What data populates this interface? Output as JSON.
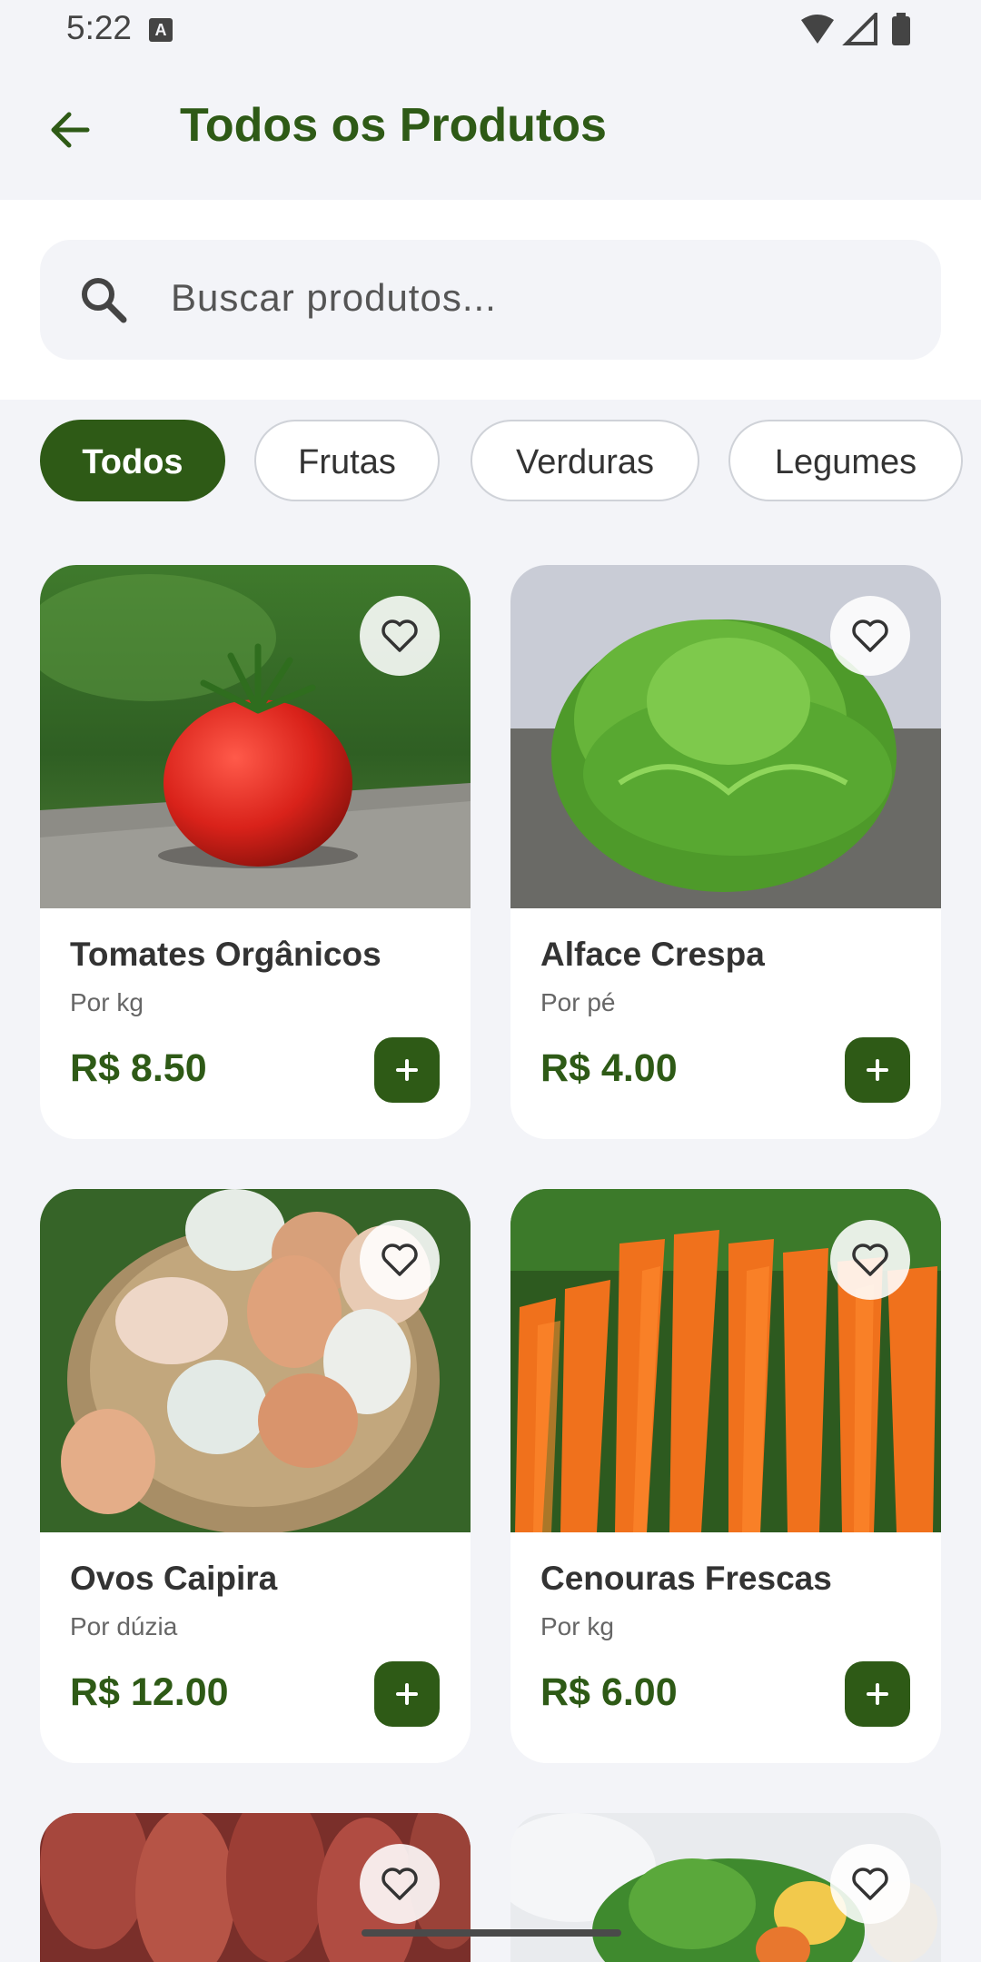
{
  "status": {
    "time": "5:22",
    "notification_glyph": "A"
  },
  "appbar": {
    "title": "Todos os Produtos"
  },
  "search": {
    "placeholder": "Buscar produtos..."
  },
  "filters": [
    {
      "label": "Todos",
      "active": true
    },
    {
      "label": "Frutas",
      "active": false
    },
    {
      "label": "Verduras",
      "active": false
    },
    {
      "label": "Legumes",
      "active": false
    }
  ],
  "products": [
    {
      "name": "Tomates Orgânicos",
      "unit": "Por kg",
      "price": "R$ 8.50",
      "image": "tomato"
    },
    {
      "name": "Alface Crespa",
      "unit": "Por pé",
      "price": "R$ 4.00",
      "image": "lettuce"
    },
    {
      "name": "Ovos Caipira",
      "unit": "Por dúzia",
      "price": "R$ 12.00",
      "image": "eggs"
    },
    {
      "name": "Cenouras Frescas",
      "unit": "Por kg",
      "price": "R$ 6.00",
      "image": "carrots"
    }
  ],
  "colors": {
    "brand": "#2e5a16",
    "background": "#f3f4f8"
  },
  "icons": [
    "back-arrow-icon",
    "search-icon",
    "heart-outline-icon",
    "plus-icon",
    "wifi-icon",
    "signal-icon",
    "battery-icon"
  ]
}
